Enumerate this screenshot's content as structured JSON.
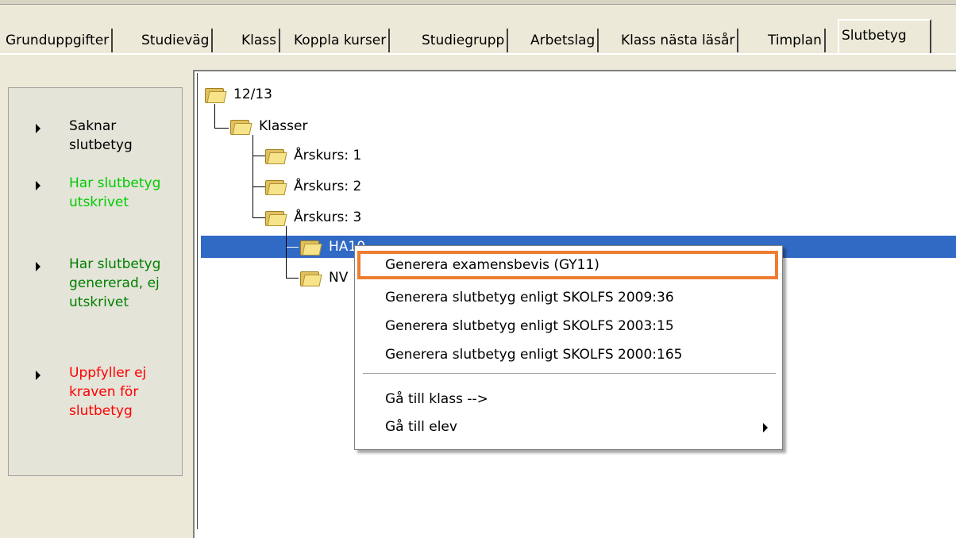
{
  "tabs": [
    {
      "label": "Grunduppgifter"
    },
    {
      "label": "Studieväg"
    },
    {
      "label": "Klass"
    },
    {
      "label": "Koppla kurser"
    },
    {
      "label": "Studiegrupp"
    },
    {
      "label": "Arbetslag"
    },
    {
      "label": "Klass nästa läsår"
    },
    {
      "label": "Timplan"
    },
    {
      "label": "Slutbetyg",
      "active": true
    }
  ],
  "legend": {
    "items": [
      {
        "label": "Saknar slutbetyg",
        "color": "#000000"
      },
      {
        "label": "Har slutbetyg utskrivet",
        "color": "#00cc00"
      },
      {
        "label": "Har slutbetyg genererad, ej utskrivet",
        "color": "#008000"
      },
      {
        "label": "Uppfyller ej kraven för slutbetyg",
        "color": "#ff0000"
      }
    ]
  },
  "tree": {
    "root": "12/13",
    "klasser": "Klasser",
    "arskurs": [
      "Årskurs: 1",
      "Årskurs: 2",
      "Årskurs: 3"
    ],
    "classes": [
      "HA10",
      "NV"
    ]
  },
  "context_menu": {
    "items": [
      {
        "label": "Generera examensbevis (GY11)",
        "highlighted": true
      },
      {
        "label": "Generera slutbetyg enligt SKOLFS 2009:36"
      },
      {
        "label": "Generera slutbetyg enligt SKOLFS 2003:15"
      },
      {
        "label": "Generera slutbetyg enligt SKOLFS 2000:165"
      },
      {
        "label": "Gå till klass -->"
      },
      {
        "label": "Gå till elev",
        "submenu": true
      }
    ]
  },
  "colors": {
    "selection": "#316ac5",
    "highlight_outline": "#ed7d31"
  }
}
